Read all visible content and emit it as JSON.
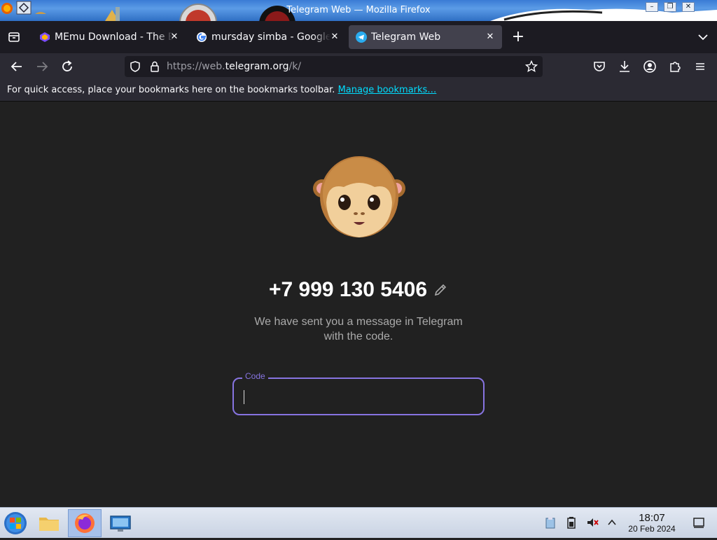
{
  "window": {
    "title": "Telegram Web — Mozilla Firefox",
    "buttons": [
      "minimize",
      "maximize",
      "close"
    ]
  },
  "tabs": [
    {
      "label": "MEmu Download - The Best",
      "favicon": "memu-icon",
      "active": false
    },
    {
      "label": "mursday simba - Google Se",
      "favicon": "google-icon",
      "active": false
    },
    {
      "label": "Telegram Web",
      "favicon": "telegram-icon",
      "active": true
    }
  ],
  "navbar": {
    "url_prefix": "https://web.",
    "url_domain": "telegram.org",
    "url_suffix": "/k/"
  },
  "bookmarks": {
    "message": "For quick access, place your bookmarks here on the bookmarks toolbar.",
    "link": "Manage bookmarks…"
  },
  "login": {
    "phone": "+7 999 130 5406",
    "subtitle_line1": "We have sent you a message in Telegram",
    "subtitle_line2": "with the code.",
    "code_label": "Code",
    "code_value": ""
  },
  "taskbar": {
    "time": "18:07",
    "date": "20 Feb 2024"
  },
  "colors": {
    "accent": "#8774e1",
    "page_bg": "#212121",
    "link": "#00ddff"
  }
}
